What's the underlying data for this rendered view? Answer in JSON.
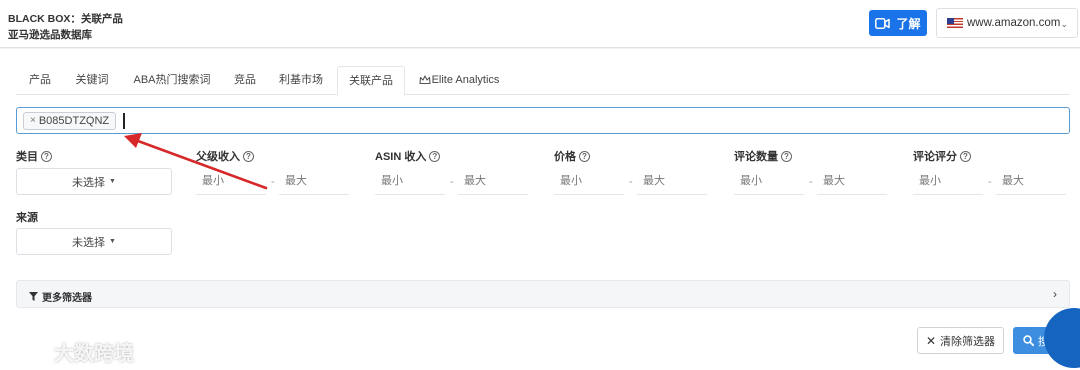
{
  "header": {
    "title": "BLACK BOX：关联产品",
    "subtitle": "亚马逊选品数据库",
    "learn_label": "了解",
    "market": "www.amazon.com"
  },
  "tabs": [
    {
      "label": "产品"
    },
    {
      "label": "关键词"
    },
    {
      "label": "ABA热门搜索词"
    },
    {
      "label": "竞品"
    },
    {
      "label": "利基市场"
    },
    {
      "label": "关联产品",
      "active": true
    },
    {
      "label": "Elite Analytics"
    }
  ],
  "asin_input": {
    "chip_remove": "×",
    "chip": "B085DTZQNZ"
  },
  "filters": {
    "category": {
      "label": "类目",
      "value": "未选择"
    },
    "parent_revenue": {
      "label": "父级收入",
      "min": "最小",
      "max": "最大"
    },
    "asin_revenue": {
      "label": "ASIN 收入",
      "min": "最小",
      "max": "最大"
    },
    "price": {
      "label": "价格",
      "min": "最小",
      "max": "最大"
    },
    "review_count": {
      "label": "评论数量",
      "min": "最小",
      "max": "最大"
    },
    "review_rating": {
      "label": "评论评分",
      "min": "最小",
      "max": "最大"
    },
    "source": {
      "label": "来源",
      "value": "未选择"
    },
    "dash": "-",
    "help": "?"
  },
  "more_filters": {
    "label": "更多筛选器"
  },
  "actions": {
    "clear": "清除筛选器",
    "search": "搜索"
  },
  "watermark": {
    "text": "大数跨境"
  },
  "colors": {
    "primary": "#1a73e8",
    "search_button": "#3d8ee0",
    "annotation_arrow": "#d62828"
  }
}
